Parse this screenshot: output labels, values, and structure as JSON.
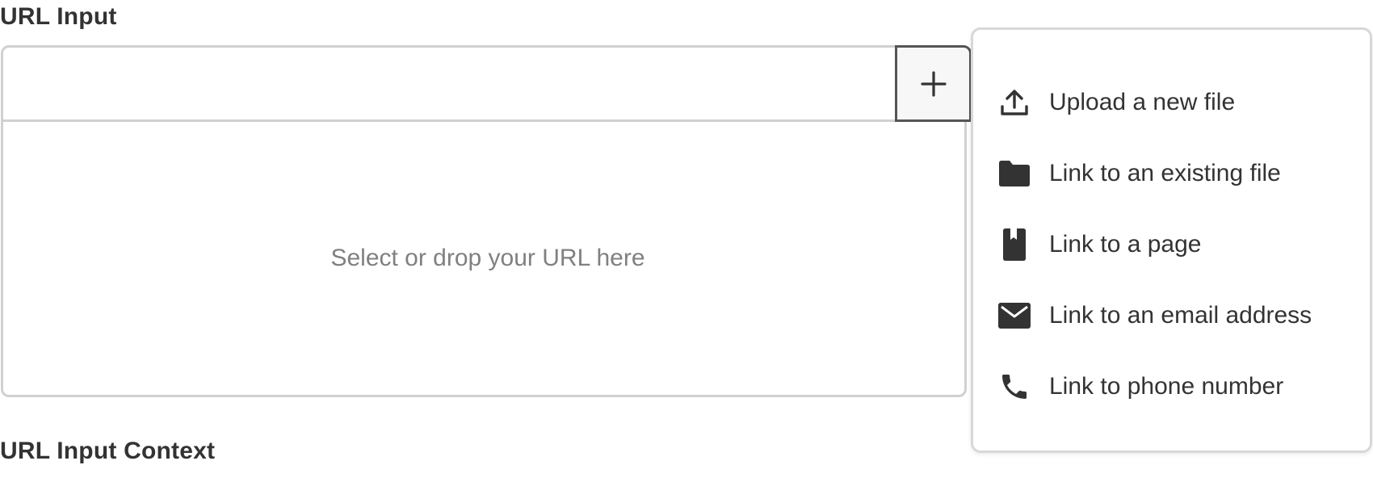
{
  "labels": {
    "url_input": "URL Input",
    "url_input_context": "URL Input Context"
  },
  "url_field": {
    "value": "",
    "add_button_label": "+",
    "drop_placeholder": "Select or drop your URL here"
  },
  "menu": {
    "items": [
      {
        "label": "Upload a new file",
        "icon": "upload-icon"
      },
      {
        "label": "Link to an existing file",
        "icon": "folder-icon"
      },
      {
        "label": "Link to a page",
        "icon": "bookmark-icon"
      },
      {
        "label": "Link to an email address",
        "icon": "envelope-icon"
      },
      {
        "label": "Link to phone number",
        "icon": "phone-icon"
      }
    ]
  },
  "colors": {
    "text": "#333333",
    "muted_text": "#808080",
    "border": "#d0d0d0",
    "icon": "#333333"
  }
}
